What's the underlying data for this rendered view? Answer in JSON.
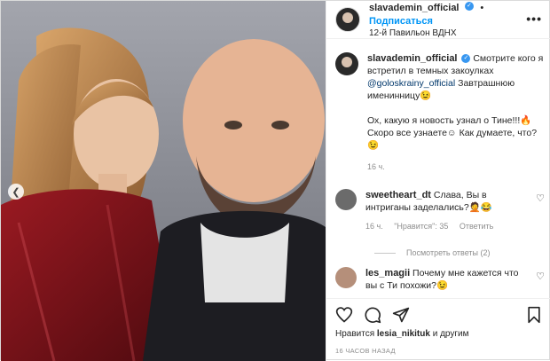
{
  "header": {
    "username": "slavademin_official",
    "dot": "•",
    "follow_label": "Подписаться",
    "location": "12-й Павильон ВДНХ",
    "more": "•••"
  },
  "caption": {
    "username": "slavademin_official",
    "text1": " Смотрите кого я встретил в темных закоулках ",
    "mention": "@goloskrainy_official",
    "text2": " Завтрашнюю именинницу",
    "emoji1": "😉",
    "text3": "Ох, какую я новость узнал о Тине!!!",
    "emoji2": "🔥",
    "text4": "Скоро все узнаете",
    "emoji3": "☺",
    "text5": " Как думаете, что?",
    "emoji4": "😉",
    "time": "16 ч."
  },
  "comments": [
    {
      "username": "sweetheart_dt",
      "text": " Слава, Вы в интриганы заделались?",
      "emoji": "🤦😂",
      "time": "16 ч.",
      "likes": "\"Нравится\": 35",
      "reply": "Ответить",
      "view_replies": "Посмотреть ответы (2)"
    },
    {
      "username": "les_magii",
      "text": " Почему мне кажется что вы с Ти похожи?",
      "emoji": "😉"
    }
  ],
  "footer": {
    "likes_prefix": "Нравится ",
    "likes_user": "lesia_nikituk",
    "likes_suffix": " и другим",
    "ago": "16 ЧАСОВ НАЗАД"
  },
  "icons": [
    "heart-icon",
    "comment-icon",
    "share-icon",
    "bookmark-icon",
    "more-icon",
    "verified-icon",
    "carousel-prev-icon"
  ],
  "colors": {
    "accent": "#0095f6",
    "verified": "#3897f0",
    "dress": "#7a1218"
  }
}
